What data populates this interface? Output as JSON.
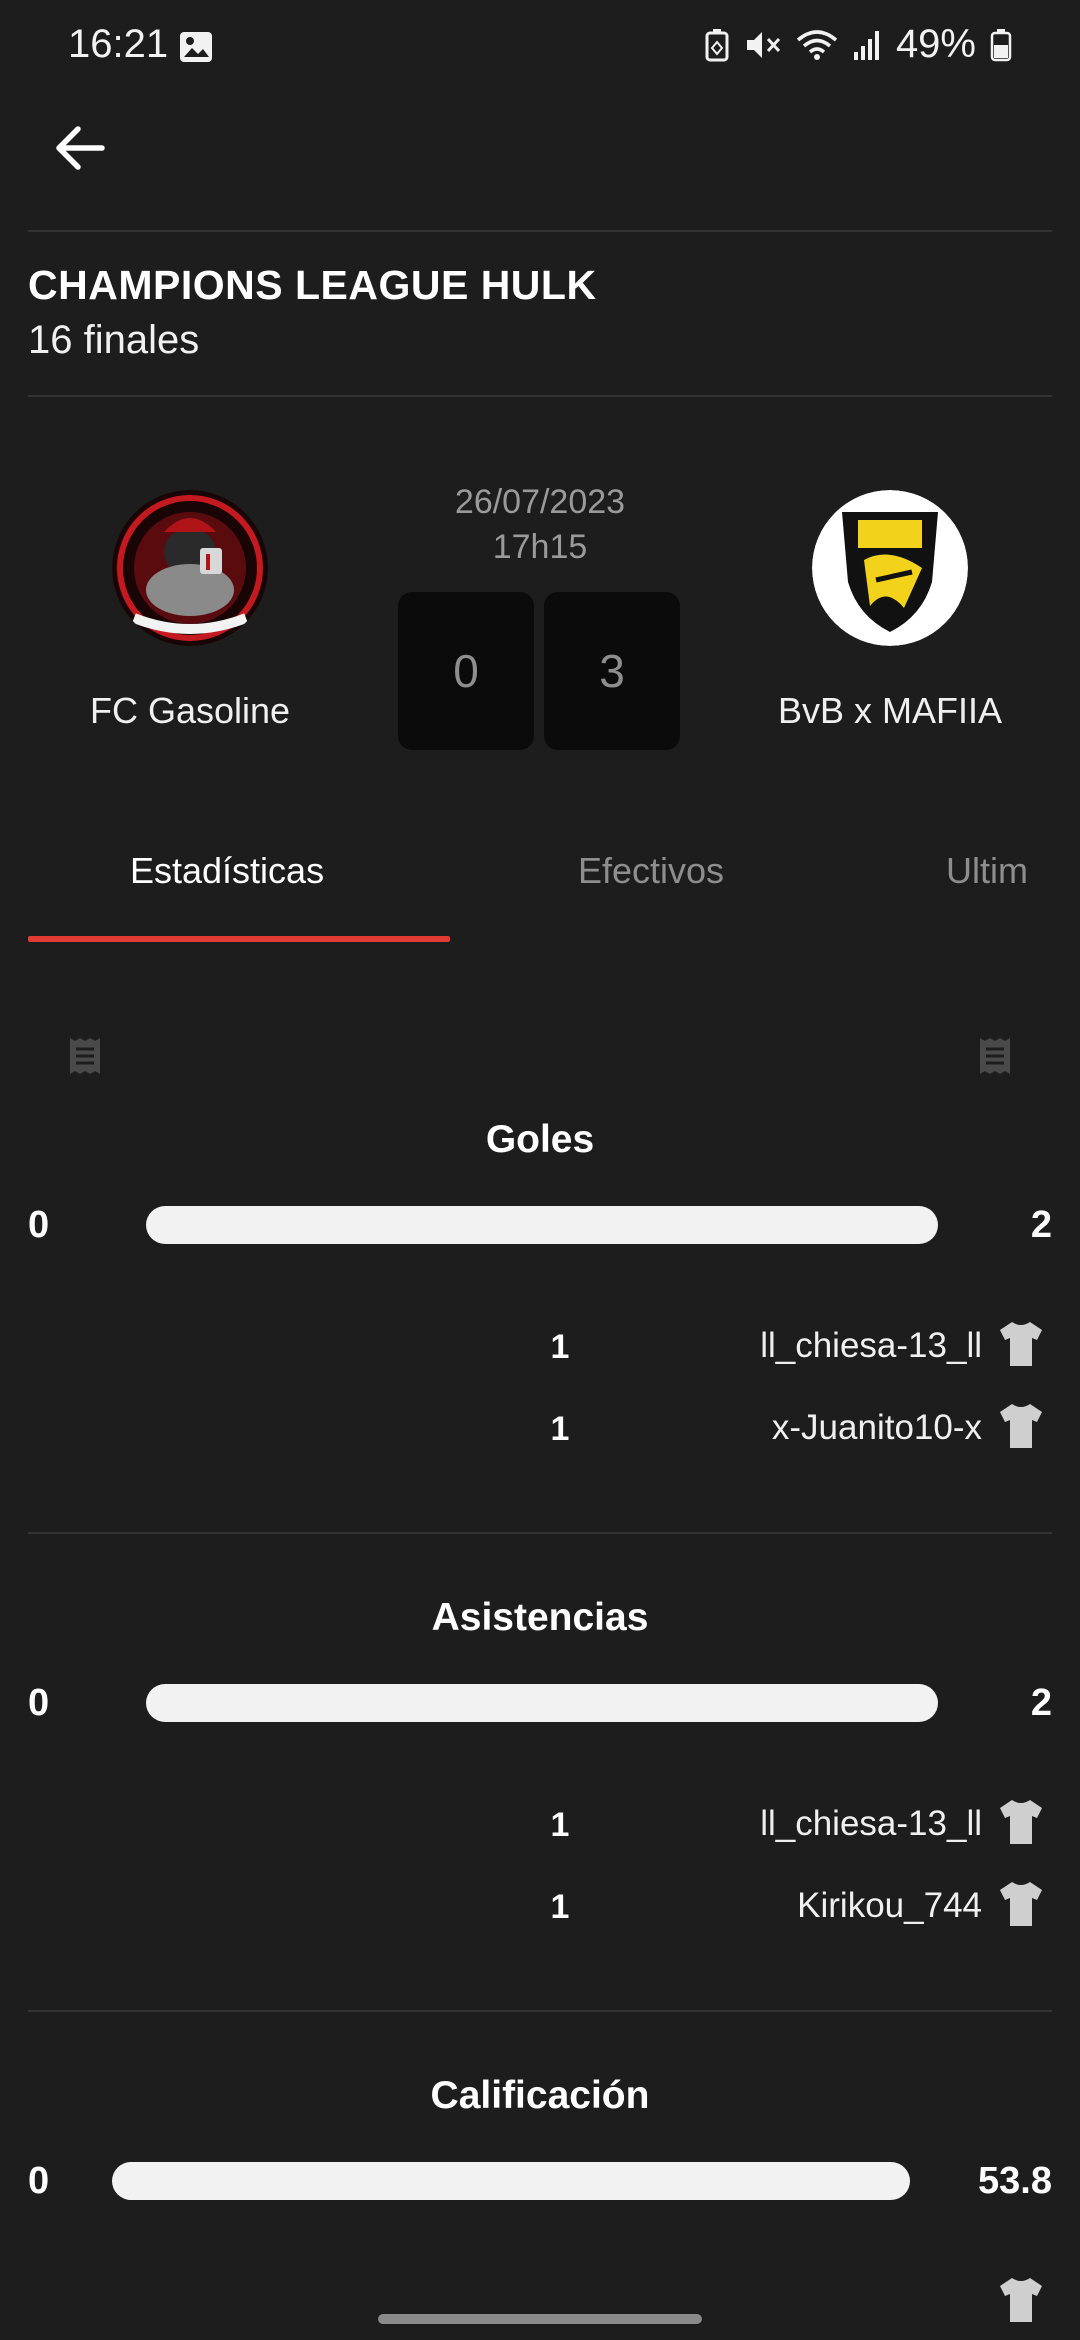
{
  "status_bar": {
    "time": "16:21",
    "battery": "49%",
    "icons": [
      "image-icon",
      "battery-saver-icon",
      "mute-icon",
      "wifi-icon",
      "signal-icon",
      "battery-icon"
    ]
  },
  "header": {
    "back_icon": "arrow-left-icon"
  },
  "competition": {
    "name": "CHAMPIONS LEAGUE HULK",
    "round": "16 finales"
  },
  "match": {
    "date": "26/07/2023",
    "time": "17h15",
    "home": {
      "name": "FC Gasoline",
      "score": "0"
    },
    "away": {
      "name": "BvB x MAFIIA",
      "score": "3"
    }
  },
  "tabs": [
    {
      "label": "Estadísticas",
      "active": true
    },
    {
      "label": "Efectivos",
      "active": false
    },
    {
      "label": "Ultim",
      "active": false
    }
  ],
  "stats": [
    {
      "title": "Goles",
      "home": "0",
      "away": "2",
      "players": [
        {
          "count": "1",
          "name": "ll_chiesa-13_ll"
        },
        {
          "count": "1",
          "name": "x-Juanito10-x"
        }
      ]
    },
    {
      "title": "Asistencias",
      "home": "0",
      "away": "2",
      "players": [
        {
          "count": "1",
          "name": "ll_chiesa-13_ll"
        },
        {
          "count": "1",
          "name": "Kirikou_744"
        }
      ]
    },
    {
      "title": "Calificación",
      "home": "0",
      "away": "53.8",
      "players": []
    }
  ],
  "colors": {
    "background": "#1d1d1d",
    "accent": "#e23b33",
    "bar": "#f2f2f2",
    "score_box": "#0b0b0b"
  }
}
